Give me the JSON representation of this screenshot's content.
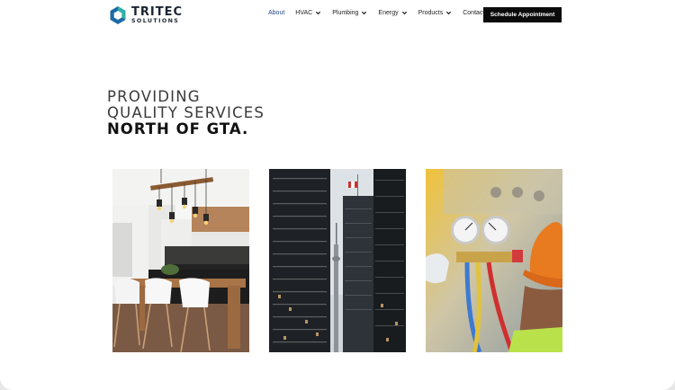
{
  "brand": {
    "name": "TRITEC",
    "tagline": "SOLUTIONS"
  },
  "nav": {
    "items": [
      {
        "label": "About",
        "dropdown": false,
        "active": true
      },
      {
        "label": "HVAC",
        "dropdown": true,
        "active": false
      },
      {
        "label": "Plumbing",
        "dropdown": true,
        "active": false
      },
      {
        "label": "Energy",
        "dropdown": true,
        "active": false
      },
      {
        "label": "Products",
        "dropdown": true,
        "active": false
      },
      {
        "label": "Contact",
        "dropdown": false,
        "active": false
      }
    ],
    "cta_label": "Schedule Appointment"
  },
  "hero": {
    "line1": "PROVIDING",
    "line2": "QUALITY SERVICES",
    "line3": "NORTH OF GTA."
  },
  "colors": {
    "accent": "#234b8a",
    "logo_blue": "#1f6aa5",
    "logo_teal": "#31b0a8",
    "cta_bg": "#0b0b0b"
  },
  "gallery": [
    {
      "subject": "kitchen interior with dining table and white chairs"
    },
    {
      "subject": "city skyscrapers with tall tower"
    },
    {
      "subject": "technician with refrigerant pressure gauges"
    }
  ]
}
